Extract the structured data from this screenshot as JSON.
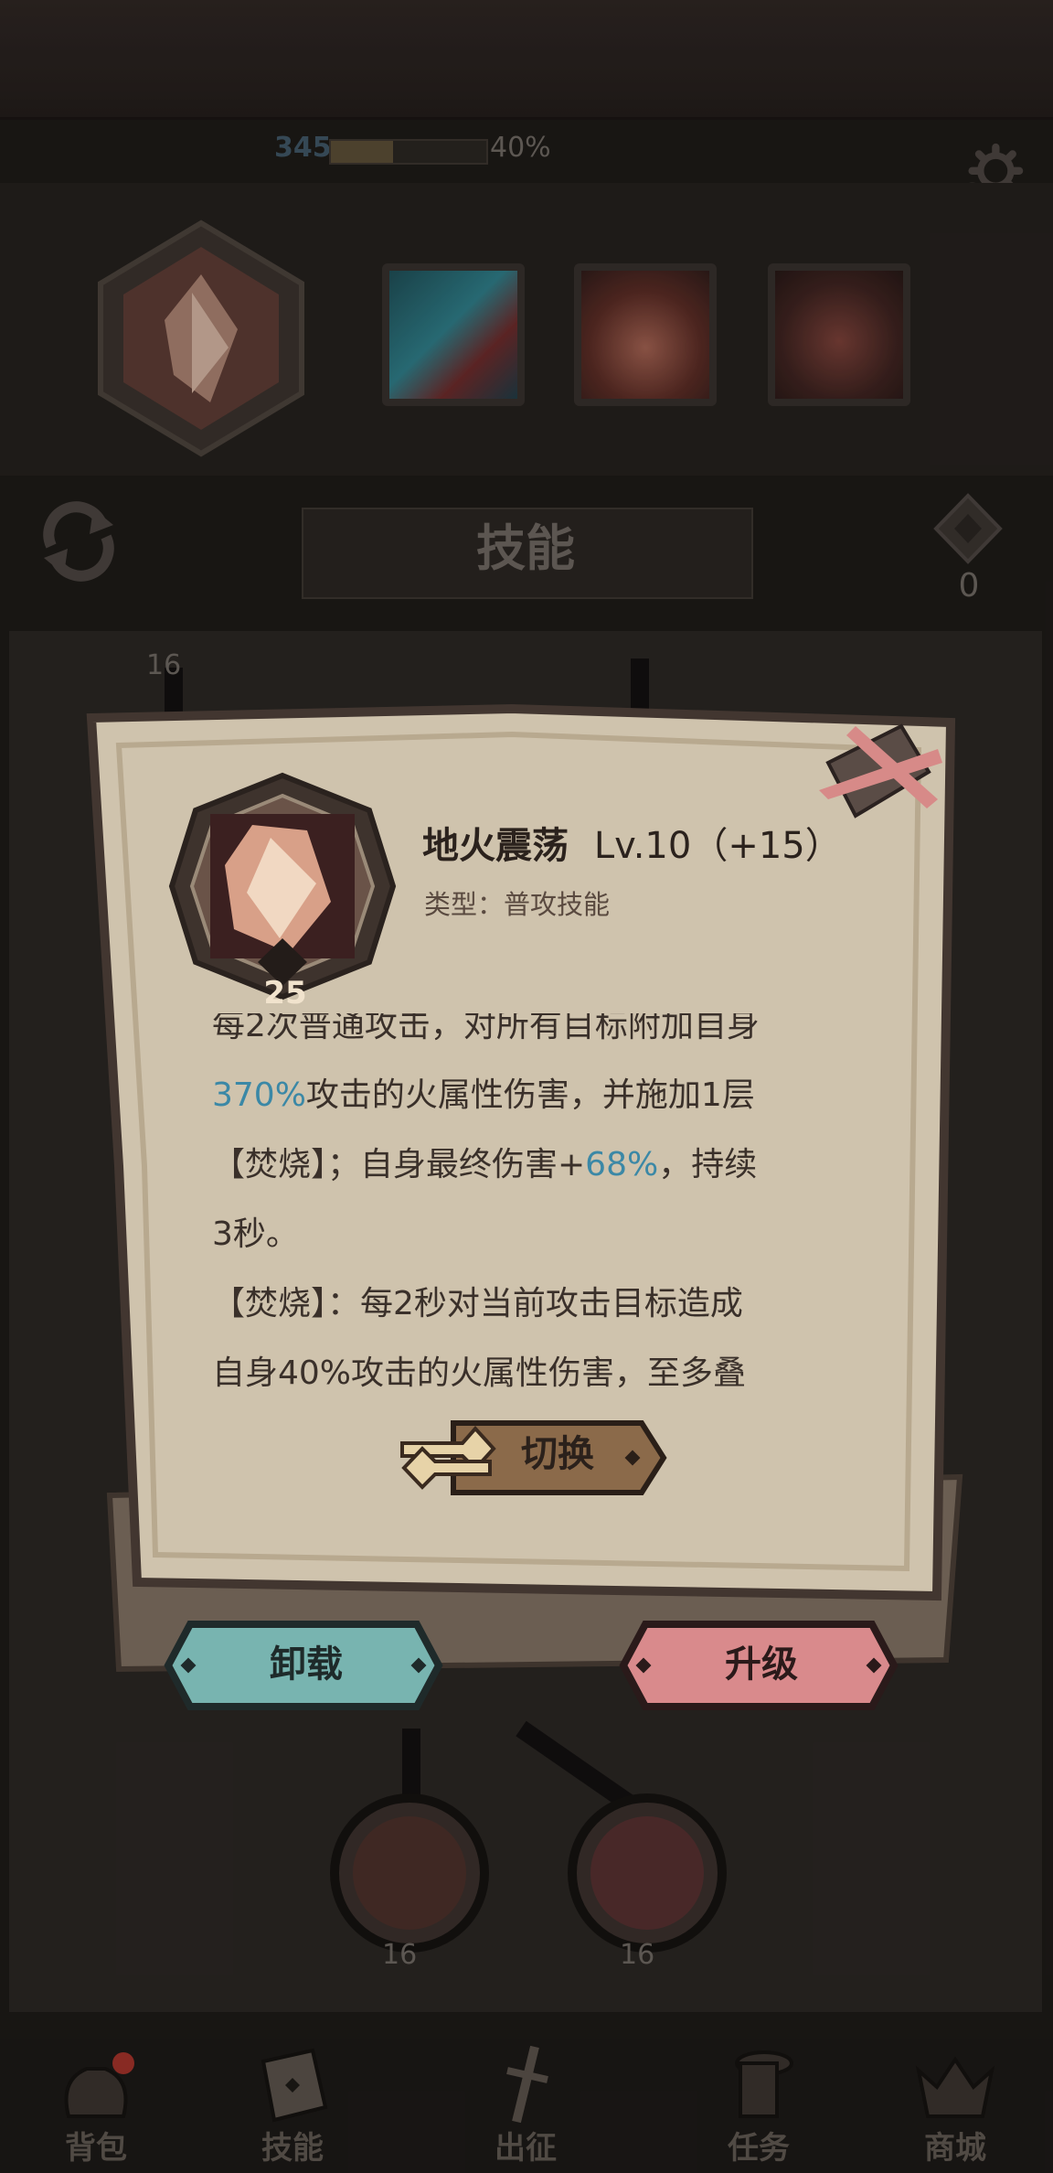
{
  "hud": {
    "level": "345",
    "xp_percent": "40%",
    "xp_progress": 0.4,
    "skill_points": "0"
  },
  "equipped_skills": [
    {
      "name": "main-skill",
      "active": true
    },
    {
      "name": "skill-2",
      "color": "#2e7b86"
    },
    {
      "name": "skill-3",
      "color": "#7a3a2c"
    },
    {
      "name": "skill-4",
      "color": "#5a2c25"
    }
  ],
  "section": {
    "title": "技能"
  },
  "tree": {
    "node_levels": [
      "16",
      "16",
      "16"
    ]
  },
  "dialog": {
    "skill_name": "地火震荡",
    "skill_level": "Lv.10（+15）",
    "skill_type": "类型：普攻技能",
    "icon_badge": "25",
    "desc_lines": {
      "l0": "每2次普通攻击，对所有目标附加自身",
      "l1_hl": "370%",
      "l1": "攻击的火属性伤害，并施加1层",
      "l2a": "【焚烧】；自身最终伤害+",
      "l2_hl": "68%",
      "l2b": "，持续",
      "l3": "3秒。",
      "l4": "【焚烧】：每2秒对当前攻击目标造成",
      "l5": "自身40%攻击的火属性伤害，至多叠"
    },
    "switch_label": "切换",
    "unequip_label": "卸载",
    "upgrade_label": "升级"
  },
  "colors": {
    "parchment": "#cfc3ad",
    "highlight": "#3b88a6",
    "teal_button": "#78b4b0",
    "pink_button": "#d98a8c",
    "brown_button": "#8b6a4a"
  },
  "nav": {
    "bag": "背包",
    "skills": "技能",
    "expedition": "出征",
    "tasks": "任务",
    "shop": "商城"
  }
}
